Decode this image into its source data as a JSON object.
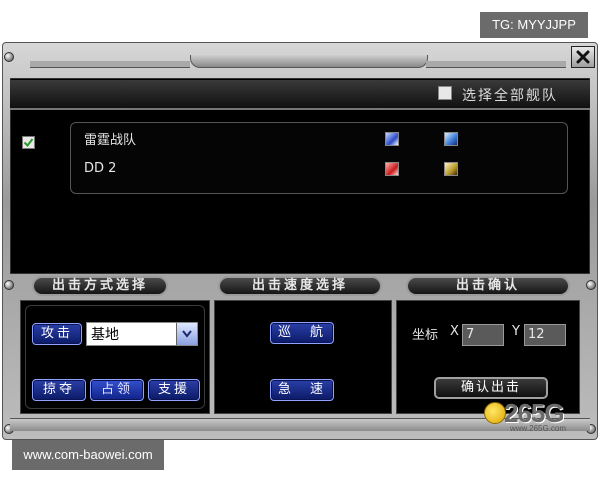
{
  "watermarks": {
    "top_right": "TG: MYYJJPP",
    "bottom_left": "www.com-baowei.com"
  },
  "fleet_panel": {
    "select_all_label": "选择全部舰队",
    "select_all_checked": false,
    "fleets": [
      {
        "name": "雷霆战队",
        "checked": true,
        "icons": [
          "ship-blue-icon",
          "ship-blue-icon"
        ]
      },
      {
        "name": "DD 2",
        "checked": false,
        "icons": [
          "ship-red-icon",
          "ship-gold-icon"
        ]
      }
    ]
  },
  "sections": {
    "mode": {
      "title": "出击方式选择",
      "attack_label": "攻击",
      "target_select": {
        "value": "基地"
      },
      "buttons": [
        "掠夺",
        "占领",
        "支援"
      ],
      "selected_button": "占领"
    },
    "speed": {
      "title": "出击速度选择",
      "buttons": [
        "巡　航",
        "急　速"
      ]
    },
    "confirm": {
      "title": "出击确认",
      "coord_label": "坐标",
      "x_label": "X",
      "x_value": "7",
      "y_label": "Y",
      "y_value": "12",
      "confirm_button": "确认出击"
    }
  },
  "logo": {
    "text": "265G",
    "sub": "www.265G.com"
  },
  "colors": {
    "button_blue": "#1a2c8c",
    "panel_black": "#000000",
    "frame_gray": "#a8a8a8",
    "check_green": "#2a9a2a"
  }
}
